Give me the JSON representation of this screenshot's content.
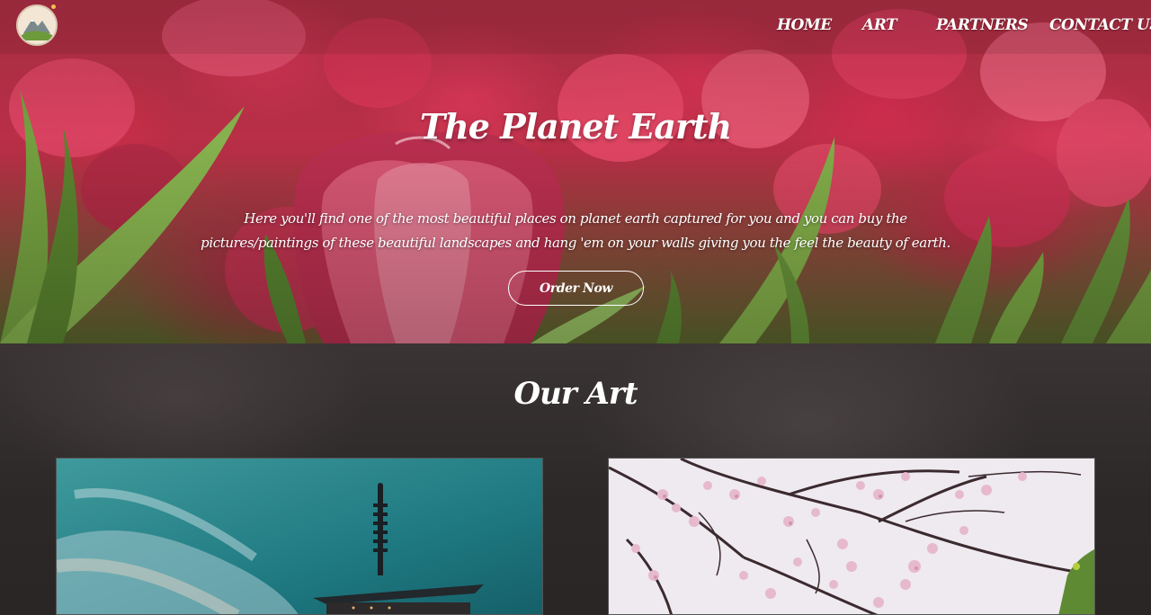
{
  "nav": {
    "logo_alt": "mountain-landscape-logo",
    "links": [
      {
        "label": "HOME"
      },
      {
        "label": "ART"
      },
      {
        "label": "PARTNERS"
      },
      {
        "label": "CONTACT US"
      }
    ]
  },
  "hero": {
    "title": "The Planet Earth",
    "description": "Here you'll find one of the most beautiful places on planet earth captured for you and you can buy the pictures/paintings of these beautiful landscapes and hang 'em on your walls giving you the feel the beauty of earth.",
    "cta_label": "Order Now"
  },
  "art_section": {
    "title": "Our Art",
    "cards": [
      {
        "image": "pagoda-sky-photo"
      },
      {
        "image": "cherry-blossom-photo"
      }
    ]
  },
  "colors": {
    "hero_red": "#e23a5b",
    "leaf_green": "#6f9a3a",
    "section_bg": "#2a2626",
    "text": "#ffffff"
  }
}
